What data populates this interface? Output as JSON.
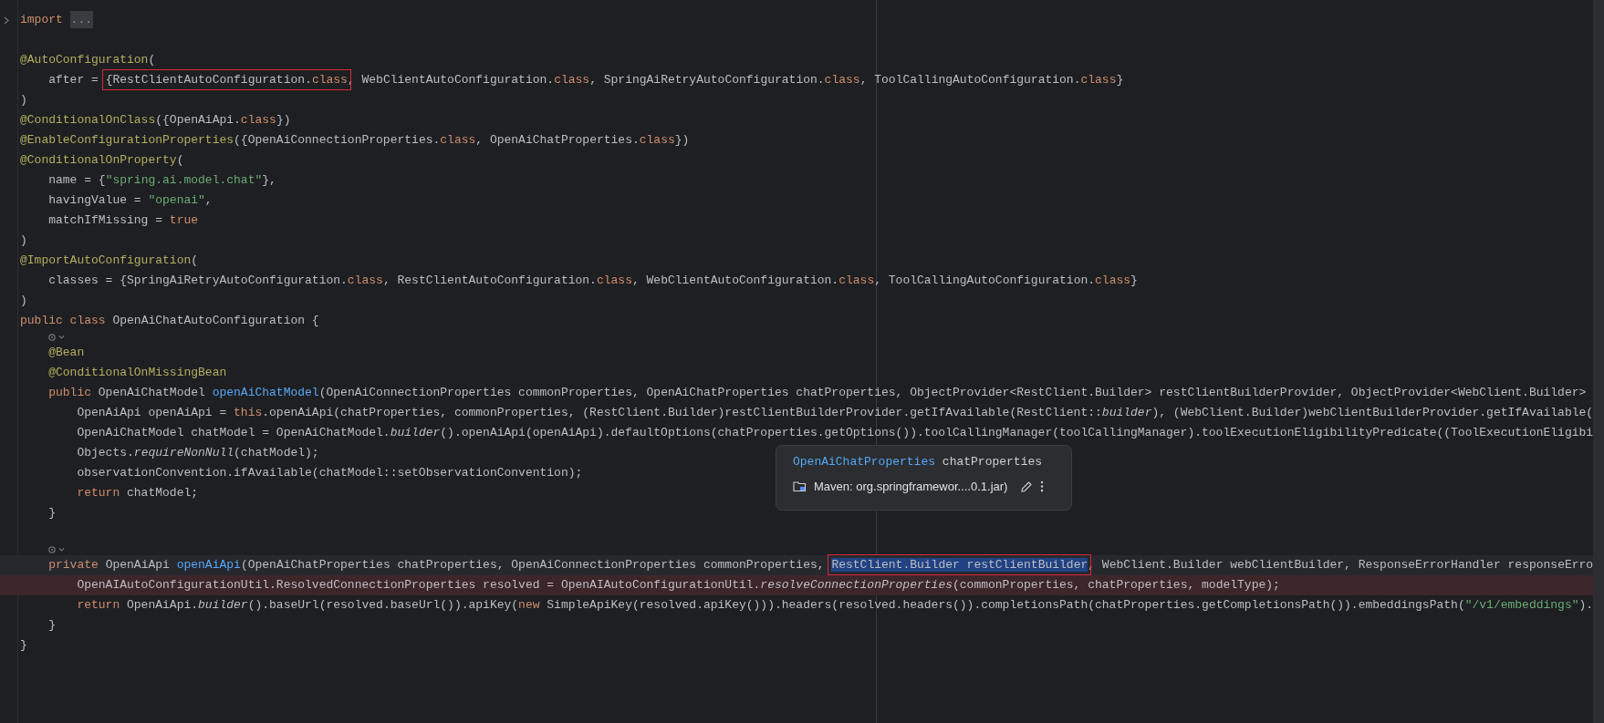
{
  "editor": {
    "lines": [
      {
        "kind": "code",
        "collapsed": true,
        "tokens": [
          {
            "text": "import ",
            "kind": "kw"
          },
          {
            "text": "...",
            "kind": "fold"
          }
        ]
      },
      {
        "kind": "blank"
      },
      {
        "kind": "code",
        "tokens": [
          {
            "text": "@AutoConfiguration",
            "kind": "ann"
          },
          {
            "text": "(",
            "kind": "plain"
          }
        ]
      },
      {
        "kind": "code",
        "tokens": [
          {
            "text": "    after = ",
            "kind": "plain"
          },
          {
            "kind": "boxed",
            "parts": [
              {
                "text": "{RestClientAutoConfiguration.",
                "kind": "plain"
              },
              {
                "text": "class",
                "kind": "kw"
              }
            ]
          },
          {
            "text": ", WebClientAutoConfiguration.",
            "kind": "plain"
          },
          {
            "text": "class",
            "kind": "kw"
          },
          {
            "text": ", SpringAiRetryAutoConfiguration.",
            "kind": "plain"
          },
          {
            "text": "class",
            "kind": "kw"
          },
          {
            "text": ", ToolCallingAutoConfiguration.",
            "kind": "plain"
          },
          {
            "text": "class",
            "kind": "kw"
          },
          {
            "text": "}",
            "kind": "plain"
          }
        ]
      },
      {
        "kind": "code",
        "tokens": [
          {
            "text": ")",
            "kind": "plain"
          }
        ]
      },
      {
        "kind": "code",
        "tokens": [
          {
            "text": "@ConditionalOnClass",
            "kind": "ann"
          },
          {
            "text": "({OpenAiApi.",
            "kind": "plain"
          },
          {
            "text": "class",
            "kind": "kw"
          },
          {
            "text": "})",
            "kind": "plain"
          }
        ]
      },
      {
        "kind": "code",
        "tokens": [
          {
            "text": "@EnableConfigurationProperties",
            "kind": "ann"
          },
          {
            "text": "({OpenAiConnectionProperties.",
            "kind": "plain"
          },
          {
            "text": "class",
            "kind": "kw"
          },
          {
            "text": ", OpenAiChatProperties.",
            "kind": "plain"
          },
          {
            "text": "class",
            "kind": "kw"
          },
          {
            "text": "})",
            "kind": "plain"
          }
        ]
      },
      {
        "kind": "code",
        "tokens": [
          {
            "text": "@ConditionalOnProperty",
            "kind": "ann"
          },
          {
            "text": "(",
            "kind": "plain"
          }
        ]
      },
      {
        "kind": "code",
        "tokens": [
          {
            "text": "    name = {",
            "kind": "plain"
          },
          {
            "text": "\"spring.ai.model.chat\"",
            "kind": "str"
          },
          {
            "text": "},",
            "kind": "plain"
          }
        ]
      },
      {
        "kind": "code",
        "tokens": [
          {
            "text": "    havingValue = ",
            "kind": "plain"
          },
          {
            "text": "\"openai\"",
            "kind": "str"
          },
          {
            "text": ",",
            "kind": "plain"
          }
        ]
      },
      {
        "kind": "code",
        "tokens": [
          {
            "text": "    matchIfMissing = ",
            "kind": "plain"
          },
          {
            "text": "true",
            "kind": "kw"
          }
        ]
      },
      {
        "kind": "code",
        "tokens": [
          {
            "text": ")",
            "kind": "plain"
          }
        ]
      },
      {
        "kind": "code",
        "tokens": [
          {
            "text": "@ImportAutoConfiguration",
            "kind": "ann"
          },
          {
            "text": "(",
            "kind": "plain"
          }
        ]
      },
      {
        "kind": "code",
        "tokens": [
          {
            "text": "    classes = {SpringAiRetryAutoConfiguration.",
            "kind": "plain"
          },
          {
            "text": "class",
            "kind": "kw"
          },
          {
            "text": ", RestClientAutoConfiguration.",
            "kind": "plain"
          },
          {
            "text": "class",
            "kind": "kw"
          },
          {
            "text": ", WebClientAutoConfiguration.",
            "kind": "plain"
          },
          {
            "text": "class",
            "kind": "kw"
          },
          {
            "text": ", ToolCallingAutoConfiguration.",
            "kind": "plain"
          },
          {
            "text": "class",
            "kind": "kw"
          },
          {
            "text": "}",
            "kind": "plain"
          }
        ]
      },
      {
        "kind": "code",
        "tokens": [
          {
            "text": ")",
            "kind": "plain"
          }
        ]
      },
      {
        "kind": "code",
        "tokens": [
          {
            "text": "public class",
            "kind": "kw"
          },
          {
            "text": " OpenAiChatAutoConfiguration {",
            "kind": "plain"
          }
        ]
      },
      {
        "kind": "hint"
      },
      {
        "kind": "code",
        "tokens": [
          {
            "text": "    @Bean",
            "kind": "ann"
          }
        ]
      },
      {
        "kind": "code",
        "tokens": [
          {
            "text": "    @ConditionalOnMissingBean",
            "kind": "ann"
          }
        ]
      },
      {
        "kind": "code",
        "tokens": [
          {
            "text": "    public",
            "kind": "kw"
          },
          {
            "text": " OpenAiChatModel ",
            "kind": "plain"
          },
          {
            "text": "openAiChatModel",
            "kind": "fn"
          },
          {
            "text": "(OpenAiConnectionProperties commonProperties, OpenAiChatProperties chatProperties, ObjectProvider<RestClient.Builder> restClientBuilderProvider, ObjectProvider<WebClient.Builder>",
            "kind": "plain"
          }
        ]
      },
      {
        "kind": "code",
        "tokens": [
          {
            "text": "        OpenAiApi openAiApi = ",
            "kind": "plain"
          },
          {
            "text": "this",
            "kind": "kw"
          },
          {
            "text": ".openAiApi(chatProperties, commonProperties, (RestClient.Builder)restClientBuilderProvider.getIfAvailable(RestClient::",
            "kind": "plain"
          },
          {
            "text": "builder",
            "kind": "italic"
          },
          {
            "text": "), (WebClient.Builder)webClientBuilderProvider.getIfAvailable(",
            "kind": "plain"
          }
        ]
      },
      {
        "kind": "code",
        "tokens": [
          {
            "text": "        OpenAiChatModel chatModel = OpenAiChatModel.",
            "kind": "plain"
          },
          {
            "text": "builder",
            "kind": "italic"
          },
          {
            "text": "().openAiApi(openAiApi).defaultOptions(chatProperties.getOptions()).toolCallingManager(toolCallingManager).toolExecutionEligibilityPredicate((ToolExecutionEligibi",
            "kind": "plain"
          }
        ]
      },
      {
        "kind": "code",
        "tokens": [
          {
            "text": "        Objects.",
            "kind": "plain"
          },
          {
            "text": "requireNonNull",
            "kind": "italic"
          },
          {
            "text": "(chatModel);",
            "kind": "plain"
          }
        ]
      },
      {
        "kind": "code",
        "tokens": [
          {
            "text": "        observationConvention.ifAvailable(chatModel::setObservationConvention);",
            "kind": "plain"
          }
        ]
      },
      {
        "kind": "code",
        "tokens": [
          {
            "text": "        return",
            "kind": "kw"
          },
          {
            "text": " chatModel;",
            "kind": "plain"
          }
        ]
      },
      {
        "kind": "code",
        "tokens": [
          {
            "text": "    }",
            "kind": "plain"
          }
        ]
      },
      {
        "kind": "blank"
      },
      {
        "kind": "hint"
      },
      {
        "kind": "code",
        "current": true,
        "tokens": [
          {
            "text": "    private",
            "kind": "kw"
          },
          {
            "text": " OpenAiApi ",
            "kind": "plain"
          },
          {
            "text": "openAiApi",
            "kind": "fn"
          },
          {
            "text": "(OpenAiChatProperties chatProperties, OpenAiConnectionProperties commonProperties, ",
            "kind": "plain"
          },
          {
            "kind": "boxed",
            "parts": [
              {
                "text": "RestClient.Builder restClientBuilder",
                "kind": "selected"
              }
            ]
          },
          {
            "text": ", WebClient.Builder webClientBuilder, ResponseErrorHandler responseErro",
            "kind": "plain"
          }
        ]
      },
      {
        "kind": "code",
        "error": true,
        "tokens": [
          {
            "text": "        OpenAIAutoConfigurationUtil.ResolvedConnectionProperties resolved = OpenAIAutoConfigurationUtil.",
            "kind": "plain"
          },
          {
            "text": "resolveConnectionProperties",
            "kind": "italic"
          },
          {
            "text": "(commonProperties, chatProperties, modelType);",
            "kind": "plain"
          }
        ]
      },
      {
        "kind": "code",
        "tokens": [
          {
            "text": "        return",
            "kind": "kw"
          },
          {
            "text": " OpenAiApi.",
            "kind": "plain"
          },
          {
            "text": "builder",
            "kind": "italic"
          },
          {
            "text": "().baseUrl(resolved.baseUrl()).apiKey(",
            "kind": "plain"
          },
          {
            "text": "new",
            "kind": "kw"
          },
          {
            "text": " SimpleApiKey(resolved.apiKey())).headers(resolved.headers()).completionsPath(chatProperties.getCompletionsPath()).embeddingsPath(",
            "kind": "plain"
          },
          {
            "text": "\"/v1/embeddings\"",
            "kind": "str"
          },
          {
            "text": ").",
            "kind": "plain"
          }
        ]
      },
      {
        "kind": "code",
        "tokens": [
          {
            "text": "    }",
            "kind": "plain"
          }
        ]
      },
      {
        "kind": "code",
        "tokens": [
          {
            "text": "}",
            "kind": "plain"
          }
        ]
      }
    ]
  },
  "popup": {
    "type_name": "OpenAiChatProperties",
    "variable": "chatProperties",
    "source": "Maven: org.springframewor....0.1.jar)"
  }
}
